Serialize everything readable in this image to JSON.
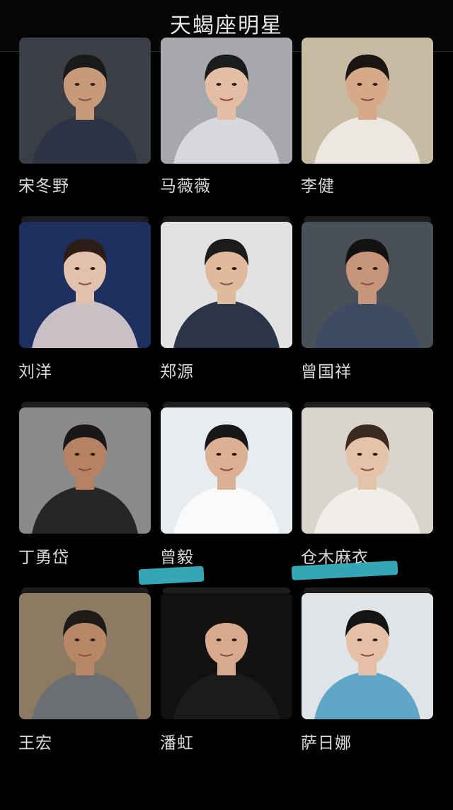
{
  "header": {
    "title": "天蝎座明星"
  },
  "celebrities": [
    {
      "name": "宋冬野",
      "photo_icon": "portrait-man-bald-dark-shirt",
      "bg": "#3b3e45",
      "skin": "#c79a7c",
      "hair": "#1a1a1a",
      "cloth": "#2b3345"
    },
    {
      "name": "马薇薇",
      "photo_icon": "portrait-woman-grey-blazer",
      "bg": "#a7a8ac",
      "skin": "#e4bea4",
      "hair": "#1c1b1b",
      "cloth": "#d8d8dc"
    },
    {
      "name": "李健",
      "photo_icon": "portrait-man-white-suit",
      "bg": "#c8bba4",
      "skin": "#d6a98a",
      "hair": "#1a1412",
      "cloth": "#ece7e0"
    },
    {
      "name": "刘洋",
      "photo_icon": "portrait-woman-blue-bokeh",
      "bg": "#1d2f5e",
      "skin": "#e2c1ad",
      "hair": "#2c1d16",
      "cloth": "#c8c0c4"
    },
    {
      "name": "郑源",
      "photo_icon": "portrait-man-navy-coat",
      "bg": "#e2e2e2",
      "skin": "#e1b99d",
      "hair": "#1d1b1a",
      "cloth": "#2c3448"
    },
    {
      "name": "曾国祥",
      "photo_icon": "portrait-man-denim-jacket",
      "bg": "#4a5058",
      "skin": "#c7967a",
      "hair": "#121212",
      "cloth": "#3d4b63"
    },
    {
      "name": "丁勇岱",
      "photo_icon": "portrait-man-close-up",
      "bg": "#8a8a88",
      "skin": "#b58364",
      "hair": "#1a1716",
      "cloth": "#262626"
    },
    {
      "name": "曾毅",
      "photo_icon": "portrait-man-white-shirt",
      "bg": "#e9ecef",
      "skin": "#dcb092",
      "hair": "#171717",
      "cloth": "#fafafa"
    },
    {
      "name": "仓木麻衣",
      "photo_icon": "portrait-woman-white-dress",
      "bg": "#d9d4cc",
      "skin": "#e5c3a8",
      "hair": "#3b2a21",
      "cloth": "#f1eee9"
    },
    {
      "name": "王宏",
      "photo_icon": "portrait-man-grey-shirt-bonsai",
      "bg": "#8d7a63",
      "skin": "#b88866",
      "hair": "#1d1a18",
      "cloth": "#6b6f73"
    },
    {
      "name": "潘虹",
      "photo_icon": "portrait-woman-glasses-dark",
      "bg": "#111111",
      "skin": "#d7aa8e",
      "hair": "#141312",
      "cloth": "#1b1b1b"
    },
    {
      "name": "萨日娜",
      "photo_icon": "portrait-woman-pearl-necklace",
      "bg": "#dfe4e8",
      "skin": "#e6c0a6",
      "hair": "#151414",
      "cloth": "#5fa6c7"
    }
  ]
}
